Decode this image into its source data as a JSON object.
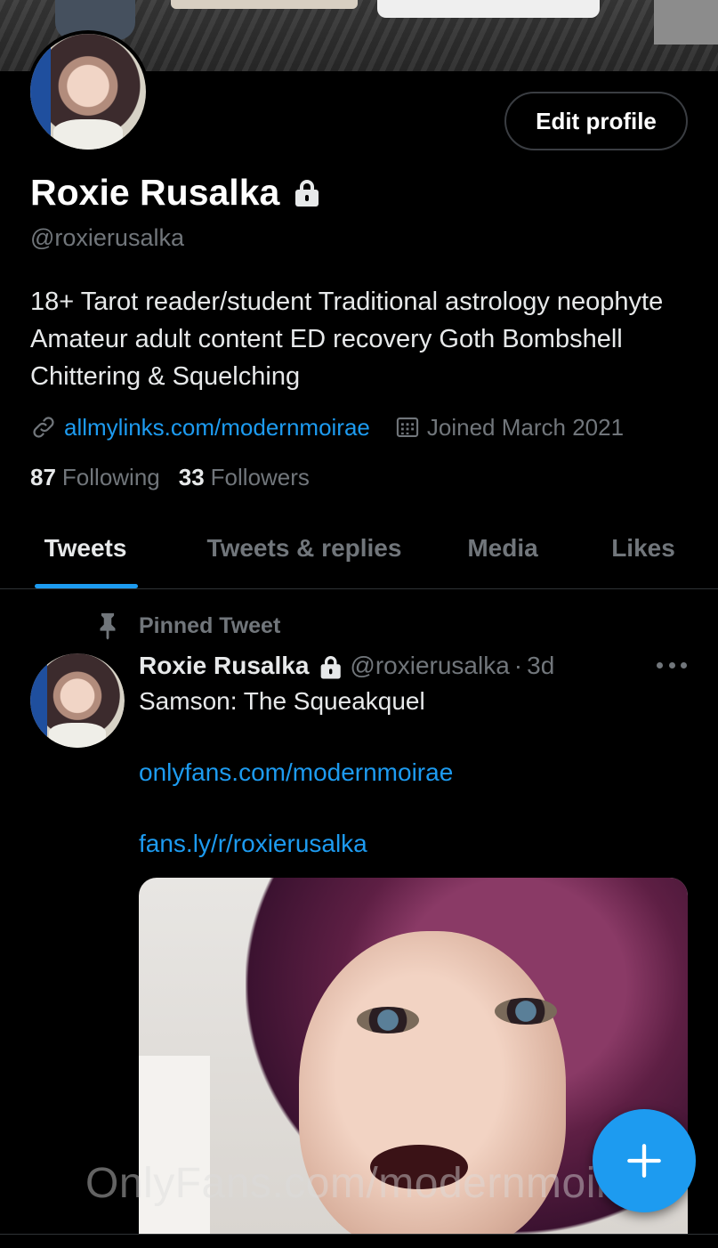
{
  "profile": {
    "display_name": "Roxie Rusalka",
    "handle": "@roxierusalka",
    "bio": "18+ Tarot reader/student Traditional astrology neophyte Amateur adult content ED recovery Goth Bombshell Chittering & Squelching",
    "website": "allmylinks.com/modernmoirae",
    "joined": "Joined March 2021",
    "following_count": "87",
    "following_label": "Following",
    "followers_count": "33",
    "followers_label": "Followers",
    "edit_button": "Edit profile"
  },
  "tabs": [
    {
      "label": "Tweets",
      "active": true
    },
    {
      "label": "Tweets & replies",
      "active": false
    },
    {
      "label": "Media",
      "active": false
    },
    {
      "label": "Likes",
      "active": false
    }
  ],
  "pinned_tweet": {
    "pinned_label": "Pinned Tweet",
    "author_name": "Roxie Rusalka",
    "author_handle": "@roxierusalka",
    "separator": "·",
    "time": "3d",
    "text": "Samson: The Squeakquel",
    "link1": "onlyfans.com/modernmoirae",
    "link2": "fans.ly/r/roxierusalka"
  },
  "watermark": "OnlyFans.com/modernmoirae",
  "colors": {
    "background": "#000000",
    "accent": "#1d9bf0",
    "secondary_text": "#71767b",
    "primary_text": "#e7e9ea"
  },
  "icons": {
    "protected": "lock-icon",
    "website": "link-icon",
    "joined": "calendar-icon",
    "pinned": "pin-icon",
    "more": "more-icon",
    "compose": "plus-icon"
  }
}
